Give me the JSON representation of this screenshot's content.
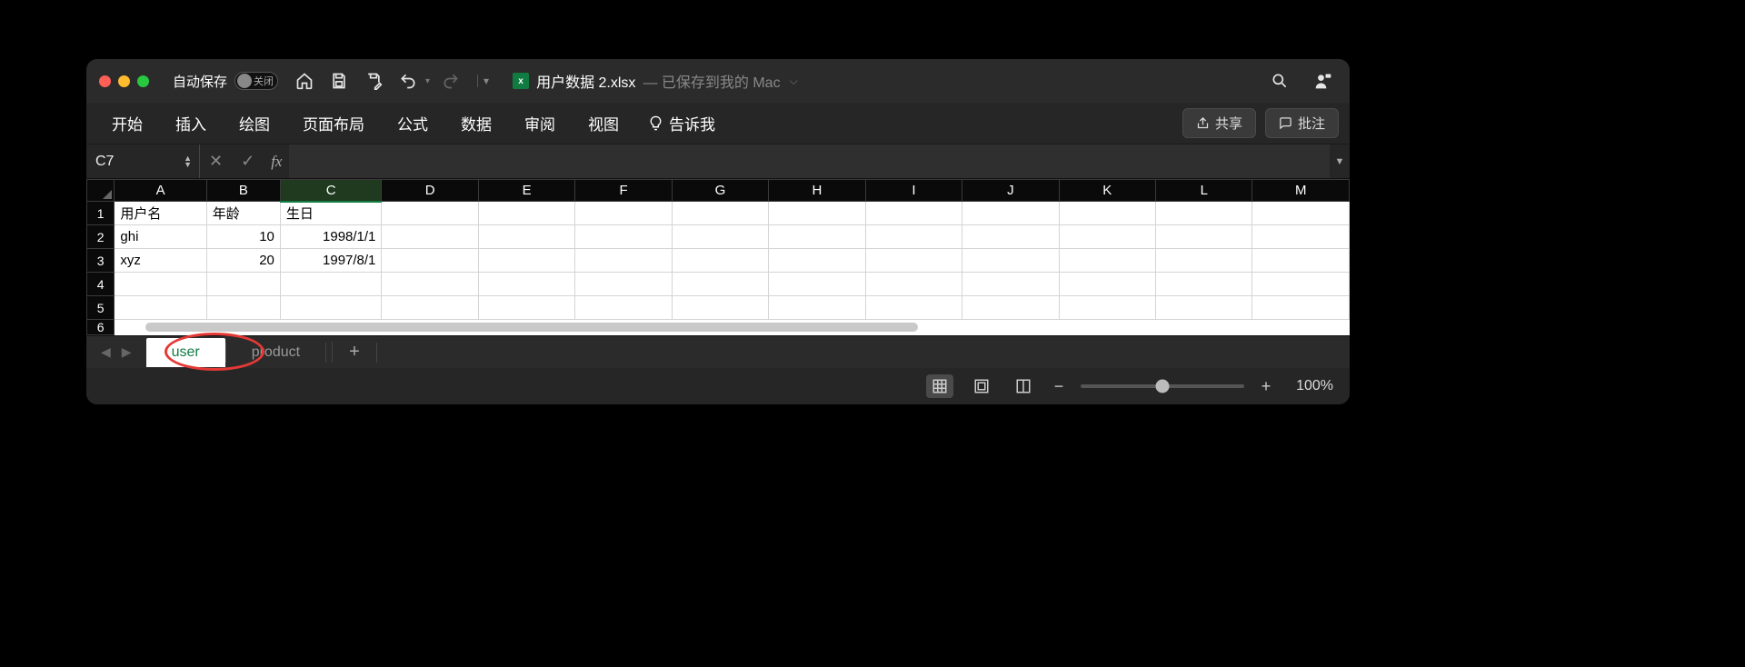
{
  "titlebar": {
    "autosave_label": "自动保存",
    "autosave_state": "关闭",
    "filename": "用户数据 2.xlsx",
    "status": "已保存到我的 Mac"
  },
  "ribbon": {
    "tabs": [
      "开始",
      "插入",
      "绘图",
      "页面布局",
      "公式",
      "数据",
      "审阅",
      "视图"
    ],
    "tell_me": "告诉我",
    "share": "共享",
    "comments": "批注"
  },
  "formula": {
    "name_box": "C7",
    "fx": "fx",
    "value": ""
  },
  "grid": {
    "columns": [
      "A",
      "B",
      "C",
      "D",
      "E",
      "F",
      "G",
      "H",
      "I",
      "J",
      "K",
      "L",
      "M"
    ],
    "row_numbers": [
      "1",
      "2",
      "3",
      "4",
      "5",
      "6"
    ],
    "rows": [
      {
        "A": "用户名",
        "B": "年龄",
        "C": "生日"
      },
      {
        "A": "ghi",
        "B": "10",
        "C": "1998/1/1"
      },
      {
        "A": "xyz",
        "B": "20",
        "C": "1997/8/1"
      },
      {
        "A": "",
        "B": "",
        "C": ""
      },
      {
        "A": "",
        "B": "",
        "C": ""
      },
      {
        "A": "",
        "B": "",
        "C": ""
      }
    ]
  },
  "sheets": {
    "active": "user",
    "tabs": [
      "user",
      "product"
    ]
  },
  "status": {
    "zoom": "100%"
  }
}
